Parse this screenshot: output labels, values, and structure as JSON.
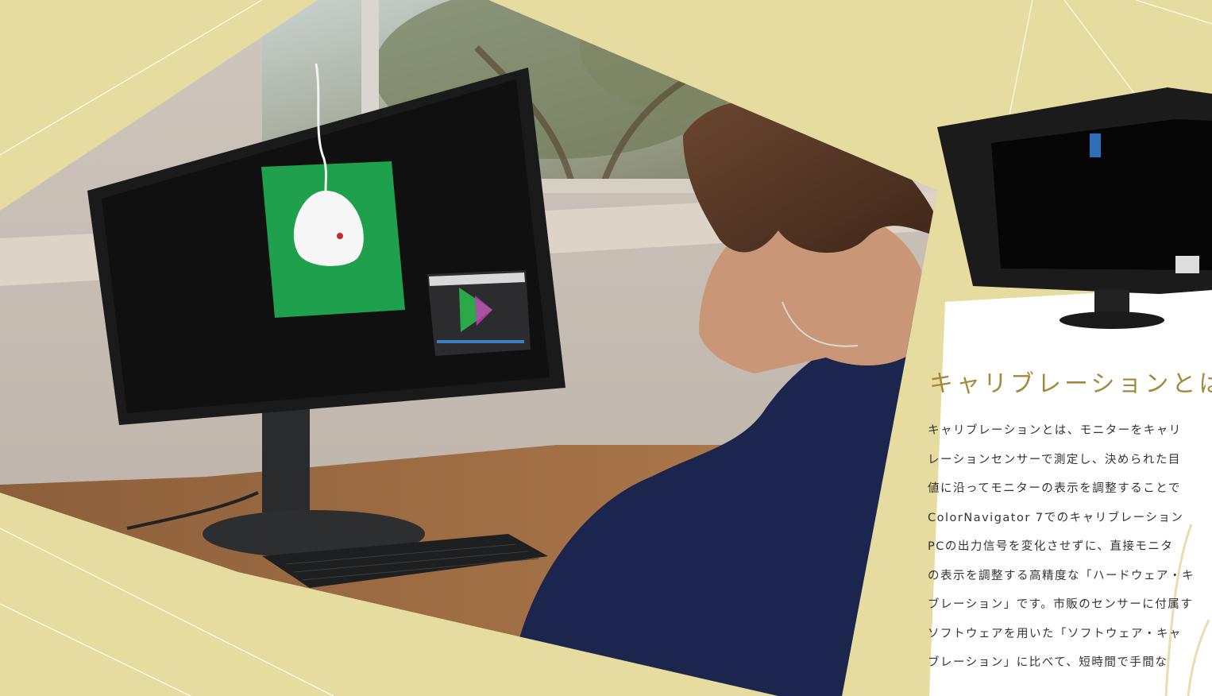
{
  "page": {
    "background_color": "#e7dc9f",
    "accent_color": "#a28a3c"
  },
  "photo": {
    "description_icon": "person-calibrating-monitor-photo",
    "screen_patch_color": "#1fa04c"
  },
  "side_product": {
    "icon": "monitor-with-hood-photo"
  },
  "article": {
    "heading": "キャリブレーションとは",
    "lines": [
      "キャリブレーションとは、モニターをキャリ",
      "レーションセンサーで測定し、決められた目",
      "値に沿ってモニターの表示を調整することで",
      "ColorNavigator 7でのキャリブレーション",
      "PCの出力信号を変化させずに、直接モニタ",
      "の表示を調整する高精度な「ハードウェア・キ",
      "ブレーション」です。市販のセンサーに付属す",
      "ソフトウェアを用いた「ソフトウェア・キャ",
      "ブレーション」に比べて、短時間で手間な"
    ]
  }
}
